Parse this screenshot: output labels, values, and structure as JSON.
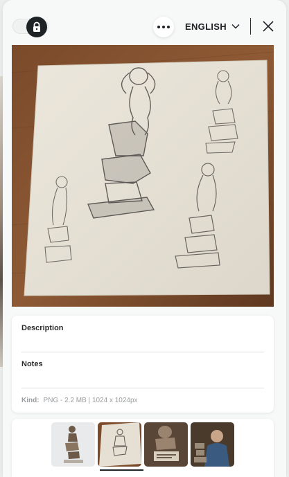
{
  "header": {
    "lock_toggle_icon": "lock-icon",
    "more_icon": "more-horizontal-icon",
    "language": "ENGLISH",
    "language_icon": "chevron-down-icon",
    "close_icon": "close-icon"
  },
  "main_image": {
    "subject": "pencil sketch of stacked-stone figure sculptures"
  },
  "details": {
    "description_label": "Description",
    "description_value": "",
    "notes_label": "Notes",
    "notes_value": "",
    "kind_label": "Kind:",
    "kind_value": "PNG - 2.2 MB | 1024 x 1024px"
  },
  "thumbnails": {
    "count": 4,
    "selected_index": 1
  },
  "colors": {
    "background": "#eceeee",
    "panel": "#f7f8f8",
    "accent_dark": "#1e2326",
    "muted_text": "#9a9d9f"
  }
}
